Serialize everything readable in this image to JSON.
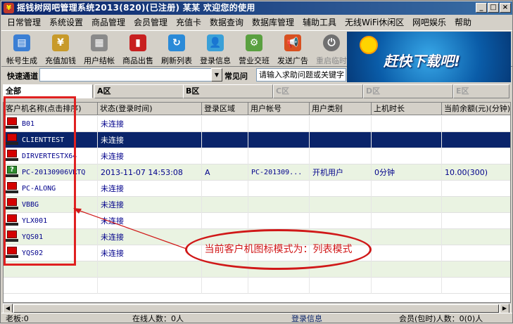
{
  "window": {
    "title": "摇钱树网吧管理系统2013(820)(已注册)  某某 欢迎您的使用",
    "controls": {
      "minimize": "_",
      "maximize": "□",
      "close": "×"
    }
  },
  "menu": [
    "日常管理",
    "系统设置",
    "商品管理",
    "会员管理",
    "充值卡",
    "数据查询",
    "数据库管理",
    "辅助工具",
    "无线WiFi休闲区",
    "网吧娱乐",
    "帮助"
  ],
  "toolbar": [
    {
      "label": "帐号生成",
      "icon": "account-generate-icon",
      "color": "#3b7fd4",
      "glyph": "▤"
    },
    {
      "label": "充值加钱",
      "icon": "recharge-icon",
      "color": "#c89a2a",
      "glyph": "¥"
    },
    {
      "label": "用户结帐",
      "icon": "checkout-icon",
      "color": "#8a8a8a",
      "glyph": "▦"
    },
    {
      "label": "商品出售",
      "icon": "cola-can-icon",
      "color": "#c82020",
      "glyph": "▮"
    },
    {
      "label": "刷新列表",
      "icon": "refresh-icon",
      "color": "#2a8ad8",
      "glyph": "↻"
    },
    {
      "label": "登录信息",
      "icon": "login-info-icon",
      "color": "#3aa0d8",
      "glyph": "👤"
    },
    {
      "label": "营业交班",
      "icon": "shift-handover-icon",
      "color": "#5aa040",
      "glyph": "⚙"
    },
    {
      "label": "发送广告",
      "icon": "megaphone-icon",
      "color": "#d85020",
      "glyph": "📢"
    },
    {
      "label": "重启临时",
      "icon": "restart-icon",
      "color": "#707070",
      "glyph": "⏻",
      "disabled": true
    },
    {
      "label": "",
      "icon": "smiley-icon",
      "color": "#e8c000",
      "glyph": "☺"
    },
    {
      "label": "",
      "icon": "power-icon",
      "color": "#d02020",
      "glyph": "⏻"
    }
  ],
  "ad": {
    "text": "赶快下载吧!"
  },
  "quick": {
    "label": "快速通道",
    "faq_label": "常见问",
    "faq_placeholder": "请输入求助问题或关键字"
  },
  "tabs": [
    {
      "label": "全部",
      "active": true
    },
    {
      "label": "A区"
    },
    {
      "label": "B区"
    },
    {
      "label": "C区",
      "disabled": true
    },
    {
      "label": "D区",
      "disabled": true
    },
    {
      "label": "E区",
      "disabled": true
    }
  ],
  "columns": [
    "客户机名称(点击排序)",
    "状态(登录时间)",
    "登录区域",
    "用户帐号",
    "用户类别",
    "上机时长",
    "当前余额(元)(分钟)"
  ],
  "rows": [
    {
      "name": "B01",
      "status": "未连接",
      "zone": "",
      "account": "",
      "type": "",
      "duration": "",
      "balance": ""
    },
    {
      "name": "CLIENTTEST",
      "status": "未连接",
      "zone": "",
      "account": "",
      "type": "",
      "duration": "",
      "balance": "",
      "selected": true
    },
    {
      "name": "DIRVERTESTX64",
      "status": "未连接",
      "zone": "",
      "account": "",
      "type": "",
      "duration": "",
      "balance": ""
    },
    {
      "name": "PC-20130906VRTQ",
      "status": "2013-11-07 14:53:08",
      "zone": "A",
      "account": "PC-201309...",
      "type": "开机用户",
      "duration": "0分钟",
      "balance": "10.00(300)",
      "online": true
    },
    {
      "name": "PC-ALONG",
      "status": "未连接",
      "zone": "",
      "account": "",
      "type": "",
      "duration": "",
      "balance": ""
    },
    {
      "name": "VBBG",
      "status": "未连接",
      "zone": "",
      "account": "",
      "type": "",
      "duration": "",
      "balance": ""
    },
    {
      "name": "YLX001",
      "status": "未连接",
      "zone": "",
      "account": "",
      "type": "",
      "duration": "",
      "balance": ""
    },
    {
      "name": "YQS01",
      "status": "未连接",
      "zone": "",
      "account": "",
      "type": "",
      "duration": "",
      "balance": ""
    },
    {
      "name": "YQS02",
      "status": "未连接",
      "zone": "",
      "account": "",
      "type": "",
      "duration": "",
      "balance": ""
    }
  ],
  "annotation": {
    "text": "当前客户机图标模式为：列表模式",
    "color": "#d01818"
  },
  "status": {
    "boss": "老板:0",
    "online": "在线人数：0人",
    "login_info": "登录信息",
    "members": "会员(包时)人数：0(0)人"
  }
}
